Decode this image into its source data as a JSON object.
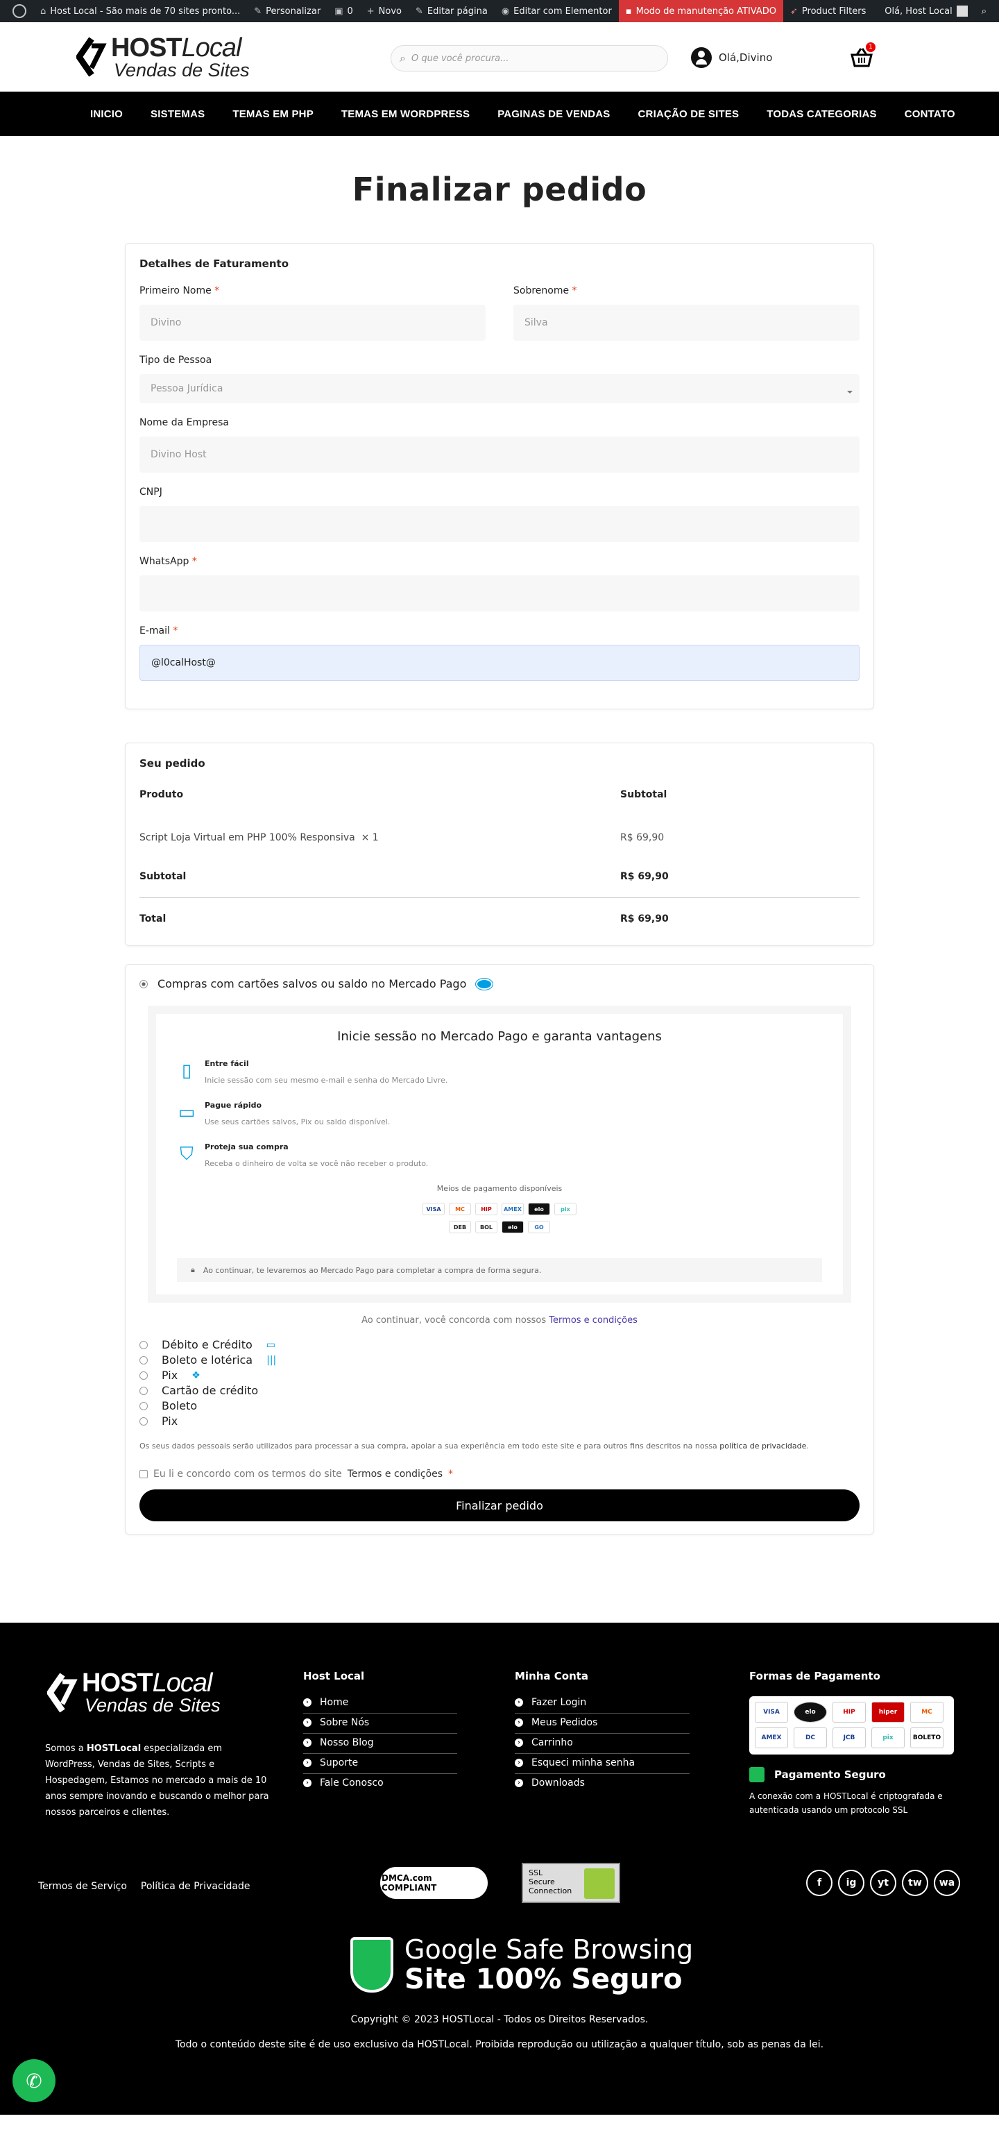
{
  "adminbar": {
    "site": "Host Local - São mais de 70 sites pronto...",
    "customize": "Personalizar",
    "comments": "0",
    "new": "Novo",
    "edit_page": "Editar página",
    "edit_elementor": "Editar com Elementor",
    "maintenance": "Modo de manutenção ATIVADO",
    "product_filters": "Product Filters",
    "greeting": "Olá, Host Local"
  },
  "header": {
    "logo_host": "HOST",
    "logo_local": "Local",
    "logo_sub": "Vendas de Sites",
    "search_placeholder": "O que você procura...",
    "user_label": "Olá,Divino",
    "cart_count": "1"
  },
  "nav": [
    "INICIO",
    "SISTEMAS",
    "TEMAS EM PHP",
    "TEMAS EM WORDPRESS",
    "PAGINAS DE VENDAS",
    "CRIAÇÃO DE SITES",
    "TODAS CATEGORIAS",
    "CONTATO"
  ],
  "page_title": "Finalizar pedido",
  "billing": {
    "heading": "Detalhes de Faturamento",
    "first_name_label": "Primeiro Nome",
    "first_name_value": "Divino",
    "last_name_label": "Sobrenome",
    "last_name_value": "Silva",
    "person_type_label": "Tipo de Pessoa",
    "person_type_value": "Pessoa Jurídica",
    "company_label": "Nome da Empresa",
    "company_value": "Divino Host",
    "cnpj_label": "CNPJ",
    "whatsapp_label": "WhatsApp",
    "email_label": "E-mail",
    "email_value": "@l0calHost@",
    "required_mark": "*"
  },
  "order": {
    "heading": "Seu pedido",
    "col_product": "Produto",
    "col_subtotal": "Subtotal",
    "item_name": "Script Loja Virtual em PHP 100% Responsiva",
    "item_qty": "× 1",
    "item_price": "R$ 69,90",
    "subtotal_label": "Subtotal",
    "subtotal_value": "R$ 69,90",
    "total_label": "Total",
    "total_value": "R$ 69,90"
  },
  "payment": {
    "mp_option": "Compras com cartões salvos ou saldo no Mercado Pago",
    "mp_title": "Inicie sessão no Mercado Pago e garanta vantagens",
    "benefits": [
      {
        "title": "Entre fácil",
        "text": "Inicie sessão com seu mesmo e-mail e senha do Mercado Livre.",
        "icon": "phone-icon"
      },
      {
        "title": "Pague rápido",
        "text": "Use seus cartões salvos, Pix ou saldo disponível.",
        "icon": "wallet-icon"
      },
      {
        "title": "Proteja sua compra",
        "text": "Receba o dinheiro de volta se você não receber o produto.",
        "icon": "shield-check-icon"
      }
    ],
    "meios_label": "Meios de pagamento disponíveis",
    "chips_row1": [
      "VISA",
      "MC",
      "HIP",
      "AMEX",
      "elo",
      "pix"
    ],
    "chips_row2": [
      "DEB",
      "BOL",
      "elo",
      "GO"
    ],
    "redirect_note": "Ao continuar, te levaremos ao Mercado Pago para completar a compra de forma segura.",
    "agree_prefix": "Ao continuar, você concorda com nossos",
    "agree_link": "Termos e condições",
    "options": [
      "Débito e Crédito",
      "Boleto e lotérica",
      "Pix",
      "Cartão de crédito",
      "Boleto",
      "Pix"
    ],
    "privacy_text": "Os seus dados pessoais serão utilizados para processar a sua compra, apoiar a sua experiência em todo este site e para outros fins descritos na nossa",
    "privacy_link": "política de privacidade",
    "terms_prefix": "Eu li e concordo com os termos do site",
    "terms_link": "Termos e condições",
    "button": "Finalizar pedido"
  },
  "footer": {
    "about_brand": "HOSTLocal",
    "about_pre": "Somos a",
    "about_text": "especializada em WordPress, Vendas de Sites, Scripts e Hospedagem, Estamos no mercado a mais de 10 anos sempre inovando e buscando o melhor para nossos parceiros e clientes.",
    "col1_title": "Host Local",
    "col1_items": [
      "Home",
      "Sobre Nós",
      "Nosso Blog",
      "Suporte",
      "Fale Conosco"
    ],
    "col2_title": "Minha Conta",
    "col2_items": [
      "Fazer Login",
      "Meus Pedidos",
      "Carrinho",
      "Esqueci minha senha",
      "Downloads"
    ],
    "col3_title": "Formas de Pagamento",
    "pay_cards": [
      "VISA",
      "elo",
      "HIP",
      "hiper",
      "MC",
      "AMEX",
      "DC",
      "JCB",
      "pix",
      "BOLETO"
    ],
    "secure_title": "Pagamento Seguro",
    "secure_text": "A conexão com a HOSTLocal é criptografada e autenticada usando um protocolo SSL",
    "legal1": "Termos de Serviço",
    "legal2": "Política de Privacidade",
    "dmca": "DMCA.com COMPLIANT",
    "ssl_l1": "SSL",
    "ssl_l2": "Secure",
    "ssl_l3": "Connection",
    "socials": [
      "f",
      "ig",
      "yt",
      "tw",
      "wa"
    ],
    "gsb_1": "Google Safe Browsing",
    "gsb_2": "Site 100% Seguro",
    "copyright": "Copyright © 2023 HOSTLocal - Todos os Direitos Reservados.",
    "notice": "Todo o conteúdo deste site é de uso exclusivo da HOSTLocal. Proibida reprodução ou utilização a qualquer título, sob as penas da lei."
  }
}
